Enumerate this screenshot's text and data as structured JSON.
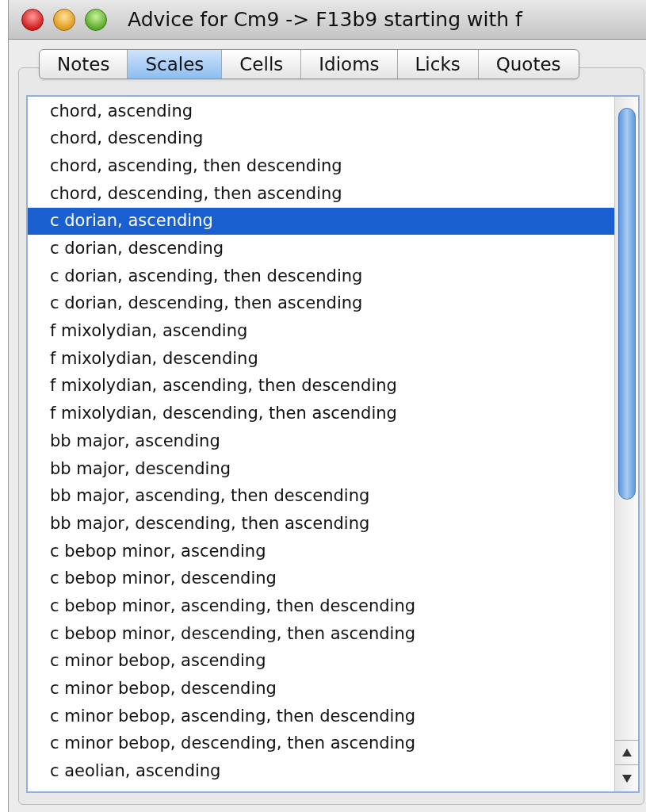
{
  "window": {
    "title": "Advice for Cm9 -> F13b9 starting with f"
  },
  "tabs": [
    {
      "label": "Notes",
      "selected": false
    },
    {
      "label": "Scales",
      "selected": true
    },
    {
      "label": "Cells",
      "selected": false
    },
    {
      "label": "Idioms",
      "selected": false
    },
    {
      "label": "Licks",
      "selected": false
    },
    {
      "label": "Quotes",
      "selected": false
    }
  ],
  "list": {
    "items": [
      {
        "label": "chord, ascending",
        "selected": false
      },
      {
        "label": "chord, descending",
        "selected": false
      },
      {
        "label": "chord, ascending, then descending",
        "selected": false
      },
      {
        "label": "chord, descending, then ascending",
        "selected": false
      },
      {
        "label": "c dorian, ascending",
        "selected": true
      },
      {
        "label": "c dorian, descending",
        "selected": false
      },
      {
        "label": "c dorian, ascending, then descending",
        "selected": false
      },
      {
        "label": "c dorian, descending, then ascending",
        "selected": false
      },
      {
        "label": "f mixolydian, ascending",
        "selected": false
      },
      {
        "label": "f mixolydian, descending",
        "selected": false
      },
      {
        "label": "f mixolydian, ascending, then descending",
        "selected": false
      },
      {
        "label": "f mixolydian, descending, then ascending",
        "selected": false
      },
      {
        "label": "bb major, ascending",
        "selected": false
      },
      {
        "label": "bb major, descending",
        "selected": false
      },
      {
        "label": "bb major, ascending, then descending",
        "selected": false
      },
      {
        "label": "bb major, descending, then ascending",
        "selected": false
      },
      {
        "label": "c bebop minor, ascending",
        "selected": false
      },
      {
        "label": "c bebop minor, descending",
        "selected": false
      },
      {
        "label": "c bebop minor, ascending, then descending",
        "selected": false
      },
      {
        "label": "c bebop minor, descending, then ascending",
        "selected": false
      },
      {
        "label": "c minor bebop, ascending",
        "selected": false
      },
      {
        "label": "c minor bebop, descending",
        "selected": false
      },
      {
        "label": "c minor bebop, ascending, then descending",
        "selected": false
      },
      {
        "label": "c minor bebop, descending, then ascending",
        "selected": false
      },
      {
        "label": "c aeolian, ascending",
        "selected": false
      }
    ]
  }
}
